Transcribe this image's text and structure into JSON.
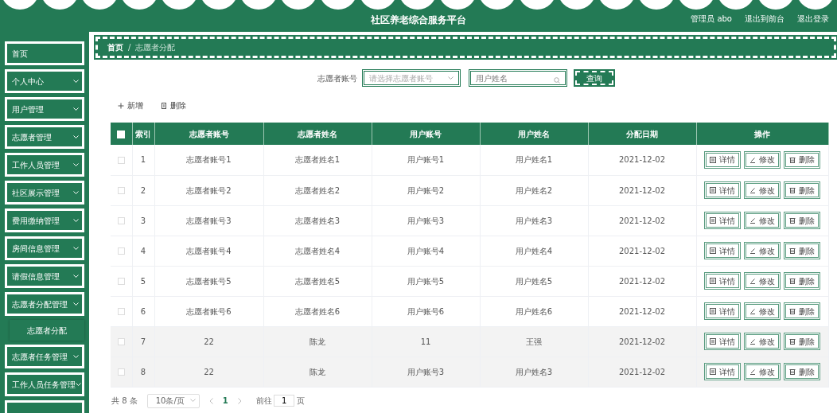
{
  "header": {
    "title": "社区养老综合服务平台",
    "links": [
      "管理员 abo",
      "退出到前台",
      "退出登录"
    ]
  },
  "sidebar": {
    "items": [
      {
        "label": "首页",
        "kind": "link"
      },
      {
        "label": "个人中心",
        "kind": "menu"
      },
      {
        "label": "用户管理",
        "kind": "menu"
      },
      {
        "label": "志愿者管理",
        "kind": "menu"
      },
      {
        "label": "工作人员管理",
        "kind": "menu"
      },
      {
        "label": "社区展示管理",
        "kind": "menu"
      },
      {
        "label": "费用缴纳管理",
        "kind": "menu"
      },
      {
        "label": "房间信息管理",
        "kind": "menu"
      },
      {
        "label": "请假信息管理",
        "kind": "menu"
      },
      {
        "label": "志愿者分配管理",
        "kind": "menu",
        "children": [
          {
            "label": "志愿者分配",
            "selected": true
          }
        ]
      },
      {
        "label": "志愿者任务管理",
        "kind": "menu"
      },
      {
        "label": "工作人员任务管理",
        "kind": "menu"
      },
      {
        "kind": "cut"
      }
    ]
  },
  "breadcrumb": {
    "items": [
      "首页",
      "志愿者分配"
    ],
    "separator": "/"
  },
  "search": {
    "label": "志愿者账号",
    "select_placeholder": "请选择志愿者账号",
    "input_placeholder": "用户姓名",
    "button": "查询"
  },
  "toolbar": [
    "新增",
    "删除"
  ],
  "table": {
    "all_checked": false,
    "columns": [
      "索引",
      "志愿者账号",
      "志愿者姓名",
      "用户账号",
      "用户姓名",
      "分配日期",
      "操作"
    ],
    "rows": [
      {
        "checked": false,
        "highlighted": false,
        "cells": [
          "1",
          "志愿者账号1",
          "志愿者姓名1",
          "用户账号1",
          "用户姓名1",
          "2021-12-02"
        ],
        "actions": [
          "详情",
          "修改",
          "删除"
        ]
      },
      {
        "checked": false,
        "highlighted": false,
        "cells": [
          "2",
          "志愿者账号2",
          "志愿者姓名2",
          "用户账号2",
          "用户姓名2",
          "2021-12-02"
        ],
        "actions": [
          "详情",
          "修改",
          "删除"
        ]
      },
      {
        "checked": false,
        "highlighted": false,
        "cells": [
          "3",
          "志愿者账号3",
          "志愿者姓名3",
          "用户账号3",
          "用户姓名3",
          "2021-12-02"
        ],
        "actions": [
          "详情",
          "修改",
          "删除"
        ]
      },
      {
        "checked": false,
        "highlighted": false,
        "cells": [
          "4",
          "志愿者账号4",
          "志愿者姓名4",
          "用户账号4",
          "用户姓名4",
          "2021-12-02"
        ],
        "actions": [
          "详情",
          "修改",
          "删除"
        ]
      },
      {
        "checked": false,
        "highlighted": false,
        "cells": [
          "5",
          "志愿者账号5",
          "志愿者姓名5",
          "用户账号5",
          "用户姓名5",
          "2021-12-02"
        ],
        "actions": [
          "详情",
          "修改",
          "删除"
        ]
      },
      {
        "checked": false,
        "highlighted": false,
        "cells": [
          "6",
          "志愿者账号6",
          "志愿者姓名6",
          "用户账号6",
          "用户姓名6",
          "2021-12-02"
        ],
        "actions": [
          "详情",
          "修改",
          "删除"
        ]
      },
      {
        "checked": false,
        "highlighted": true,
        "cells": [
          "7",
          "22",
          "陈龙",
          "11",
          "王强",
          "2021-12-02"
        ],
        "actions": [
          "详情",
          "修改",
          "删除"
        ]
      },
      {
        "checked": false,
        "highlighted": true,
        "cells": [
          "8",
          "22",
          "陈龙",
          "用户账号3",
          "用户姓名3",
          "2021-12-02"
        ],
        "actions": [
          "详情",
          "修改",
          "删除"
        ]
      }
    ]
  },
  "pagination": {
    "total": "共 8 条",
    "page_size": "10条/页",
    "pages": [
      {
        "label": "1",
        "selected": true
      }
    ],
    "goto_label": "前往",
    "goto_value": "1",
    "goto_suffix": "页"
  }
}
